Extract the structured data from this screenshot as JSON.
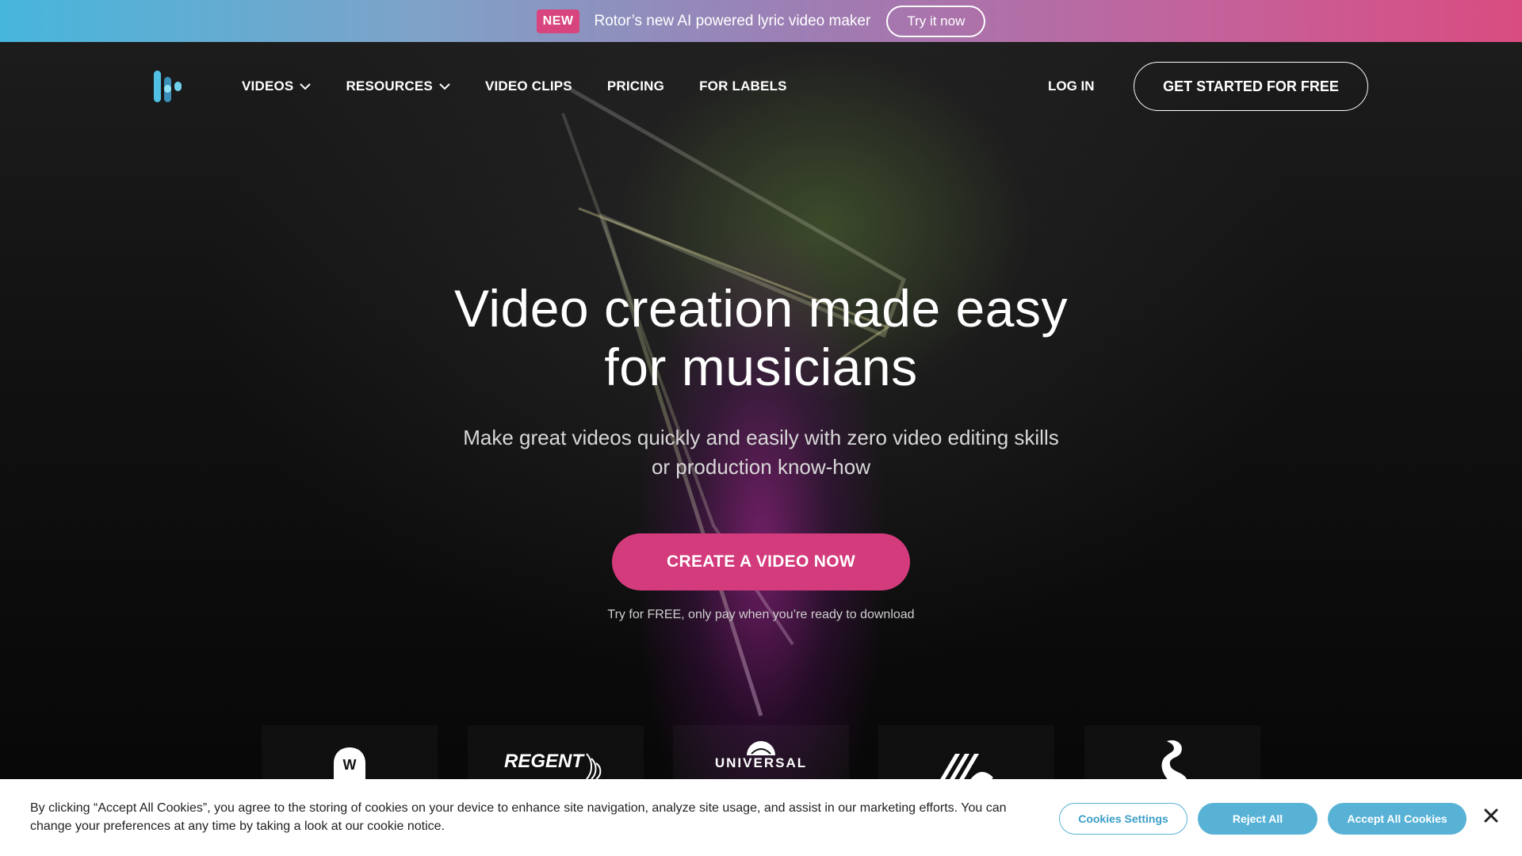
{
  "announcement": {
    "badge": "NEW",
    "text": "Rotor’s new AI powered lyric video maker",
    "button": "Try it now"
  },
  "nav": {
    "links": [
      {
        "label": "VIDEOS",
        "has_dropdown": true
      },
      {
        "label": "RESOURCES",
        "has_dropdown": true
      },
      {
        "label": "VIDEO CLIPS",
        "has_dropdown": false
      },
      {
        "label": "PRICING",
        "has_dropdown": false
      },
      {
        "label": "FOR LABELS",
        "has_dropdown": false
      }
    ],
    "login": "LOG IN",
    "cta": "GET STARTED FOR FREE"
  },
  "hero": {
    "title_line1": "Video creation made easy",
    "title_line2": "for musicians",
    "subtitle_line1": "Make great videos quickly and easily with zero video editing skills",
    "subtitle_line2": "or production know-how",
    "cta": "CREATE A VIDEO NOW",
    "note": "Try for FREE, only pay when you’re ready to download"
  },
  "logos": {
    "items": [
      "warner-music-logo",
      "regent-logo",
      "universal-logo",
      "label-stripes-logo",
      "swan-logo"
    ],
    "regent": "REGENT",
    "universal": "UNIVERSAL"
  },
  "cookie": {
    "text": "By clicking “Accept All Cookies”, you agree to the storing of cookies on your device to enhance site navigation, analyze site usage, and assist in our marketing efforts. You can change your preferences at any time by taking a look at our cookie notice.",
    "settings": "Cookies Settings",
    "reject": "Reject All",
    "accept": "Accept All Cookies"
  },
  "colors": {
    "accent_pink": "#d33b7c",
    "cookie_blue": "#57b2d6",
    "badge_pink": "#d8457e"
  }
}
